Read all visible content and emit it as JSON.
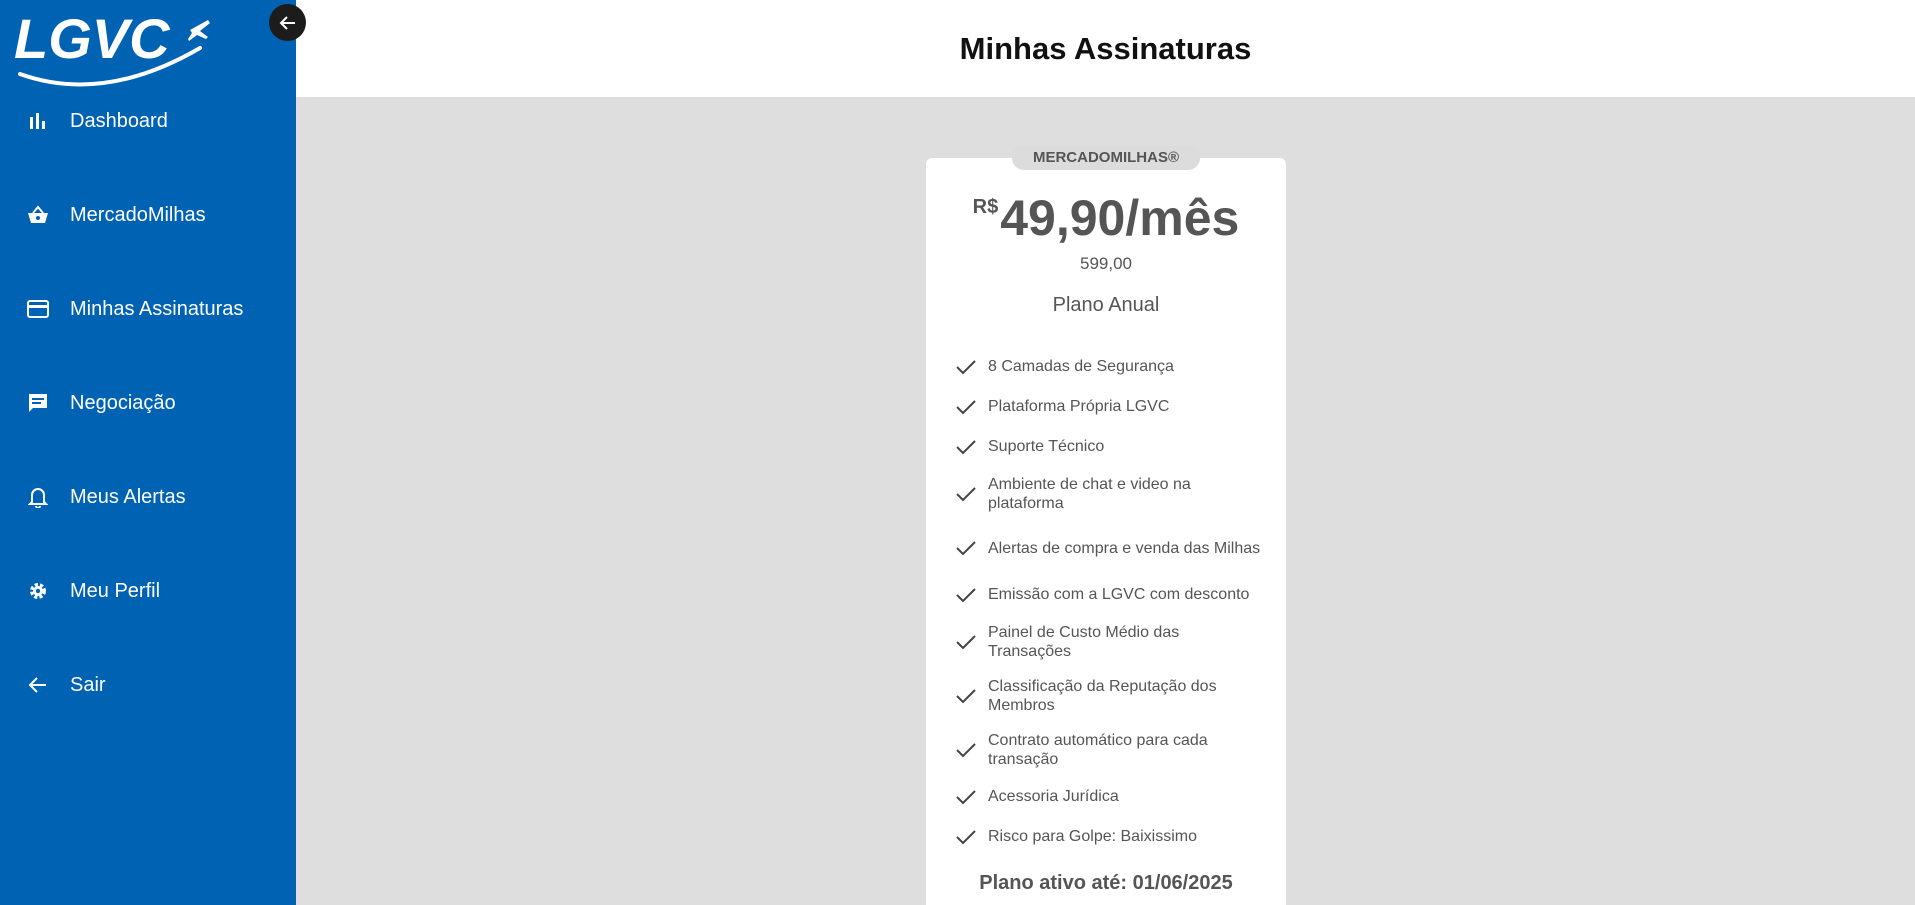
{
  "app": {
    "logo_text": "LGVC",
    "brand_color": "#0062b3"
  },
  "sidebar": {
    "items": [
      {
        "label": "Dashboard",
        "icon": "bar-chart-icon"
      },
      {
        "label": "MercadoMilhas",
        "icon": "basket-icon"
      },
      {
        "label": "Minhas Assinaturas",
        "icon": "credit-card-icon"
      },
      {
        "label": "Negociação",
        "icon": "chat-icon"
      },
      {
        "label": "Meus Alertas",
        "icon": "bell-icon"
      },
      {
        "label": "Meu Perfil",
        "icon": "gear-icon"
      },
      {
        "label": "Sair",
        "icon": "arrow-left-icon"
      }
    ]
  },
  "header": {
    "title": "Minhas Assinaturas"
  },
  "plan": {
    "badge": "MERCADOMILHAS®",
    "currency": "R$",
    "price": "49,90/mês",
    "total": "599,00",
    "name": "Plano Anual",
    "features": [
      "8 Camadas de Segurança",
      "Plataforma Própria LGVC",
      "Suporte Técnico",
      "Ambiente de chat e video na plataforma",
      "Alertas de compra e venda das Milhas",
      "Emissão com a LGVC com desconto",
      "Painel de Custo Médio das Transações",
      "Classificação da Reputação dos Membros",
      "Contrato automático para cada transação",
      "Acessoria Jurídica",
      "Risco para Golpe: Baixissimo"
    ],
    "active_until": "Plano ativo até: 01/06/2025"
  }
}
